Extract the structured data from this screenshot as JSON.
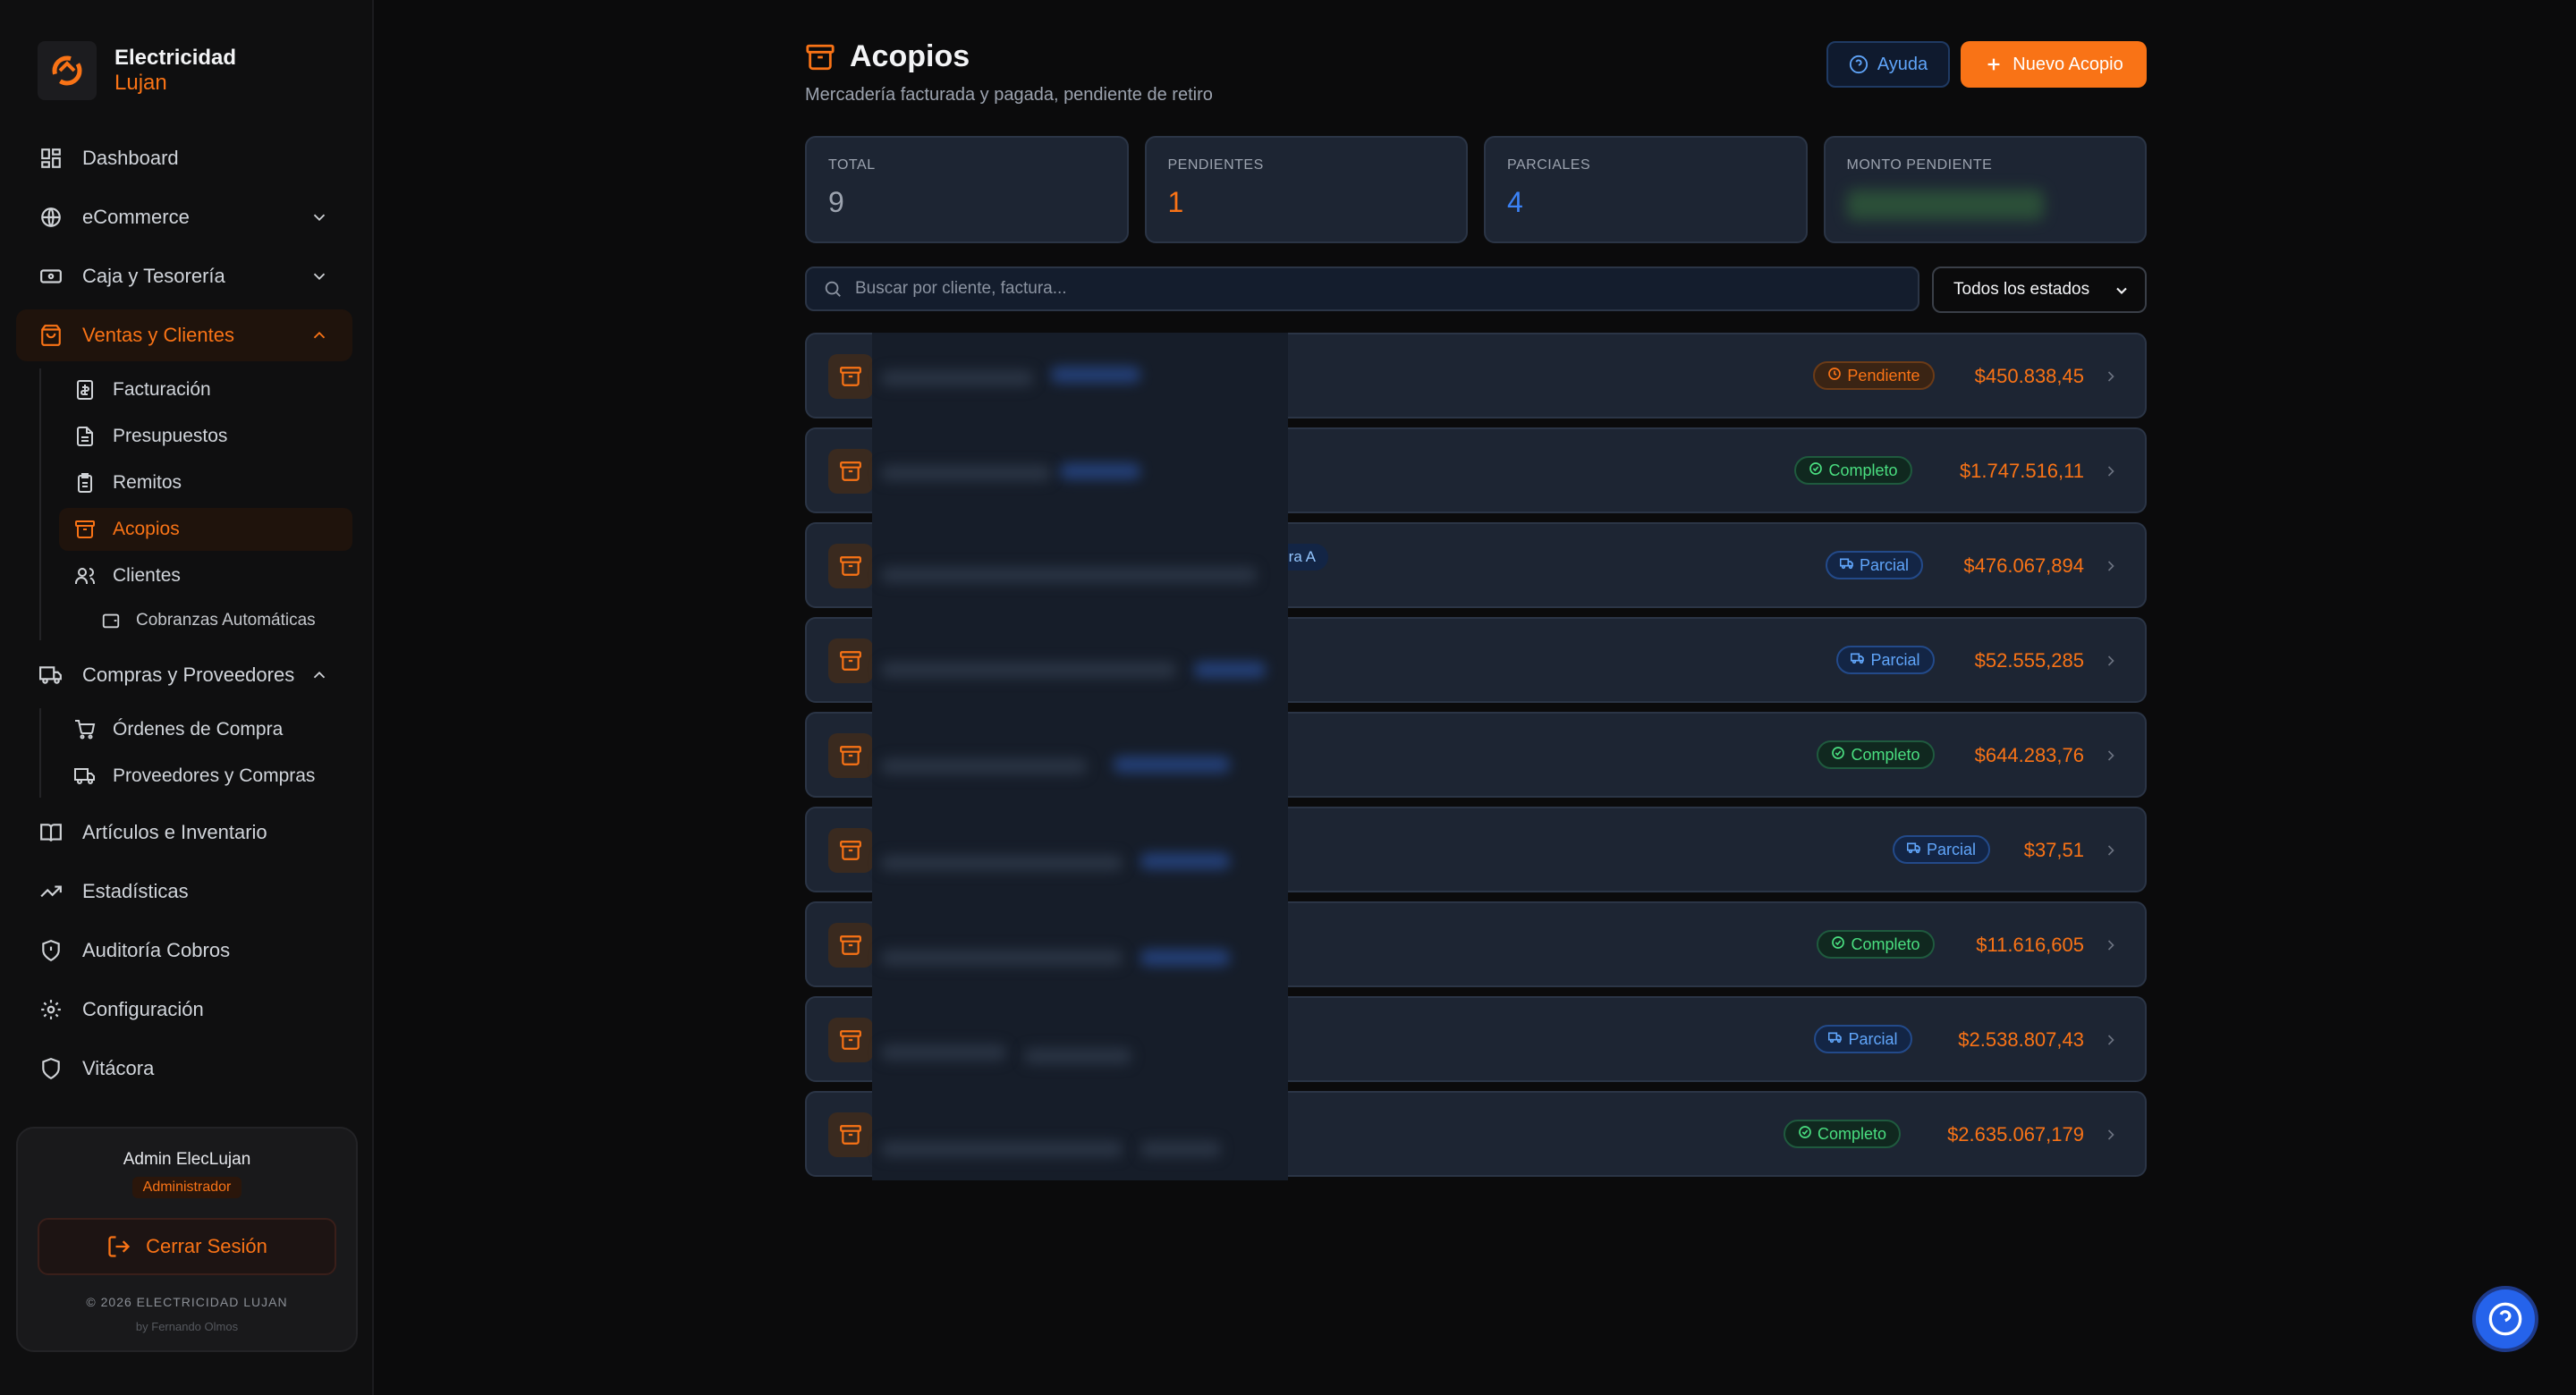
{
  "brand": {
    "line1": "Electricidad",
    "line2": "Lujan"
  },
  "sidebar": {
    "items": [
      {
        "label": "Dashboard",
        "icon": "dashboard-icon"
      },
      {
        "label": "eCommerce",
        "icon": "globe-icon",
        "chevron": "down"
      },
      {
        "label": "Caja y Tesorería",
        "icon": "cash-icon",
        "chevron": "down"
      },
      {
        "label": "Ventas y Clientes",
        "icon": "shopping-bag-icon",
        "chevron": "up",
        "active": true,
        "children": [
          {
            "label": "Facturación",
            "icon": "invoice-icon"
          },
          {
            "label": "Presupuestos",
            "icon": "document-icon"
          },
          {
            "label": "Remitos",
            "icon": "clipboard-icon"
          },
          {
            "label": "Acopios",
            "icon": "archive-icon",
            "active": true
          },
          {
            "label": "Clientes",
            "icon": "users-icon",
            "children": [
              {
                "label": "Cobranzas Automáticas",
                "icon": "wallet-icon"
              }
            ]
          }
        ]
      },
      {
        "label": "Compras y Proveedores",
        "icon": "truck-icon",
        "chevron": "up",
        "children": [
          {
            "label": "Órdenes de Compra",
            "icon": "cart-icon"
          },
          {
            "label": "Proveedores y Compras",
            "icon": "truck-icon"
          }
        ]
      },
      {
        "label": "Artículos e Inventario",
        "icon": "book-icon"
      },
      {
        "label": "Estadísticas",
        "icon": "trending-up-icon"
      },
      {
        "label": "Auditoría Cobros",
        "icon": "shield-alert-icon"
      },
      {
        "label": "Configuración",
        "icon": "gear-icon"
      },
      {
        "label": "Vitácora",
        "icon": "shield-icon"
      }
    ],
    "user": {
      "name": "Admin ElecLujan",
      "role": "Administrador",
      "logout_label": "Cerrar Sesión",
      "copyright": "© 2026 ELECTRICIDAD LUJAN",
      "byline": "by Fernando Olmos"
    }
  },
  "header": {
    "title": "Acopios",
    "subtitle": "Mercadería facturada y pagada, pendiente de retiro",
    "help_label": "Ayuda",
    "new_label": "Nuevo Acopio"
  },
  "stats": [
    {
      "label": "TOTAL",
      "value": "9",
      "color": "#9ca3af"
    },
    {
      "label": "PENDIENTES",
      "value": "1",
      "color": "#f97316"
    },
    {
      "label": "PARCIALES",
      "value": "4",
      "color": "#3b82f6"
    },
    {
      "label": "MONTO PENDIENTE",
      "value": "",
      "color": "#22c55e"
    }
  ],
  "search": {
    "placeholder": "Buscar por cliente, factura...",
    "value": ""
  },
  "filter": {
    "selected": "Todos los estados"
  },
  "rows": [
    {
      "status": "Pendiente",
      "kind": "pend",
      "amount": "$450.838,45"
    },
    {
      "status": "Completo",
      "kind": "comp",
      "amount": "$1.747.516,11"
    },
    {
      "status": "Parcial",
      "kind": "parc",
      "amount": "$476.067,894",
      "tag": "ctura A"
    },
    {
      "status": "Parcial",
      "kind": "parc",
      "amount": "$52.555,285"
    },
    {
      "status": "Completo",
      "kind": "comp",
      "amount": "$644.283,76"
    },
    {
      "status": "Parcial",
      "kind": "parc",
      "amount": "$37,51"
    },
    {
      "status": "Completo",
      "kind": "comp",
      "amount": "$11.616,605"
    },
    {
      "status": "Parcial",
      "kind": "parc",
      "amount": "$2.538.807,43"
    },
    {
      "status": "Completo",
      "kind": "comp",
      "amount": "$2.635.067,179"
    }
  ],
  "colors": {
    "accent": "#f97316",
    "success": "#4ade80",
    "info": "#60a5fa",
    "background": "#0b0b0c"
  }
}
